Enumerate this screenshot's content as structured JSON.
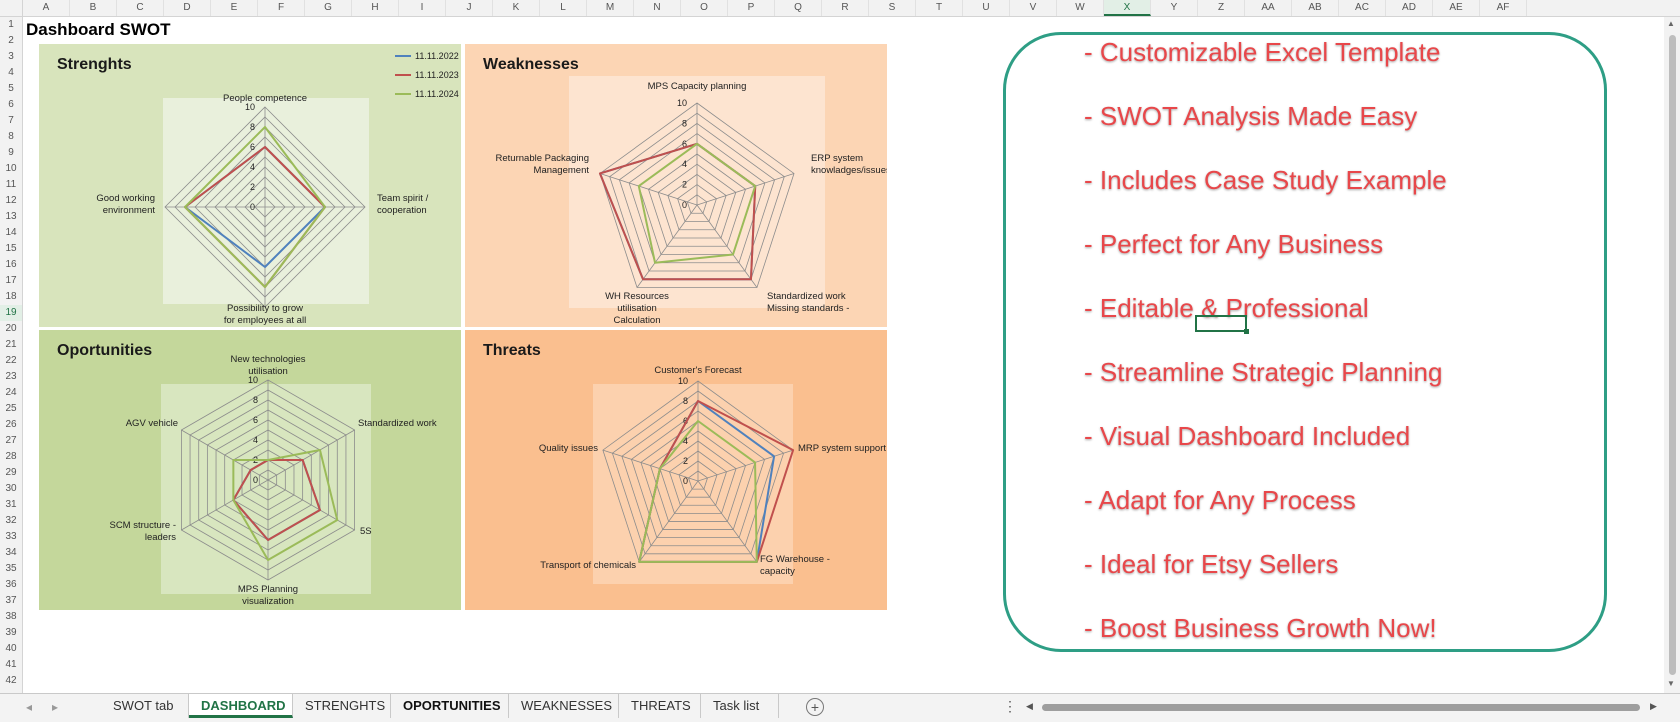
{
  "spreadsheet": {
    "columns": [
      "A",
      "B",
      "C",
      "D",
      "E",
      "F",
      "G",
      "H",
      "I",
      "J",
      "K",
      "L",
      "M",
      "N",
      "O",
      "P",
      "Q",
      "R",
      "S",
      "T",
      "U",
      "V",
      "W",
      "X",
      "Y",
      "Z",
      "AA",
      "AB",
      "AC",
      "AD",
      "AE",
      "AF"
    ],
    "selected_column": "X",
    "rows": [
      "1",
      "2",
      "3",
      "4",
      "5",
      "6",
      "7",
      "8",
      "9",
      "10",
      "11",
      "12",
      "13",
      "14",
      "15",
      "16",
      "17",
      "18",
      "19",
      "20",
      "21",
      "22",
      "23",
      "24",
      "25",
      "26",
      "27",
      "28",
      "29",
      "30",
      "31",
      "32",
      "33",
      "34",
      "35",
      "36",
      "37",
      "38",
      "39",
      "40",
      "41",
      "42"
    ],
    "selected_row": "19",
    "title": "Dashboard SWOT"
  },
  "legend": [
    "11.11.2022",
    "11.11.2023",
    "11.11.2024"
  ],
  "series_colors": [
    "#4f81bd",
    "#c0504d",
    "#9bbb59"
  ],
  "panels": {
    "strengths_title": "Strenghts",
    "weaknesses_title": "Weaknesses",
    "opportunities_title": "Oportunities",
    "threats_title": "Threats"
  },
  "chart_data": [
    {
      "type": "radar",
      "title": "Strenghts",
      "categories": [
        "People competence",
        "Team spirit / cooperation",
        "Possibility to grow for employees at all levels",
        "Good working environment"
      ],
      "rlim": [
        0,
        10
      ],
      "ticks": [
        "0",
        "2",
        "4",
        "6",
        "8",
        "10"
      ],
      "series": [
        {
          "name": "11.11.2022",
          "values": [
            6,
            6,
            6,
            8
          ]
        },
        {
          "name": "11.11.2023",
          "values": [
            6,
            6,
            8,
            8
          ]
        },
        {
          "name": "11.11.2024",
          "values": [
            8,
            6,
            8,
            8
          ]
        }
      ]
    },
    {
      "type": "radar",
      "title": "Weaknesses",
      "categories": [
        "MPS Capacity planning",
        "ERP system knowladges/issues",
        "Standardized work Missing standards -",
        "WH Resources utilisation Calculation",
        "Returnable Packaging Management"
      ],
      "rlim": [
        0,
        10
      ],
      "ticks": [
        "0",
        "2",
        "4",
        "6",
        "8",
        "10"
      ],
      "series": [
        {
          "name": "11.11.2022",
          "values": [
            6,
            6,
            9,
            9,
            10
          ]
        },
        {
          "name": "11.11.2023",
          "values": [
            6,
            6,
            9,
            9,
            10
          ]
        },
        {
          "name": "11.11.2024",
          "values": [
            6,
            6,
            6,
            7,
            6
          ]
        }
      ]
    },
    {
      "type": "radar",
      "title": "Oportunities",
      "categories": [
        "New technologies utilisation",
        "Standardized work",
        "5S",
        "MPS Planning visualization",
        "SCM structure - leaders",
        "AGV vehicle"
      ],
      "rlim": [
        0,
        10
      ],
      "ticks": [
        "0",
        "2",
        "4",
        "6",
        "8",
        "10"
      ],
      "series": [
        {
          "name": "11.11.2022",
          "values": [
            2,
            4,
            6,
            6,
            4,
            2
          ]
        },
        {
          "name": "11.11.2023",
          "values": [
            2,
            4,
            6,
            6,
            4,
            2
          ]
        },
        {
          "name": "11.11.2024",
          "values": [
            2,
            6,
            8,
            8,
            4,
            4
          ]
        }
      ]
    },
    {
      "type": "radar",
      "title": "Threats",
      "categories": [
        "Customer's Forecast",
        "MRP system support",
        "FG Warehouse - capacity",
        "Transport of chemicals",
        "Quality issues"
      ],
      "rlim": [
        0,
        10
      ],
      "ticks": [
        "0",
        "2",
        "4",
        "6",
        "8",
        "10"
      ],
      "series": [
        {
          "name": "11.11.2022",
          "values": [
            8,
            8,
            10,
            10,
            4
          ]
        },
        {
          "name": "11.11.2023",
          "values": [
            8,
            10,
            10,
            10,
            4
          ]
        },
        {
          "name": "11.11.2024",
          "values": [
            6,
            6,
            10,
            10,
            4
          ]
        }
      ]
    }
  ],
  "promo": {
    "items": [
      "- Customizable Excel Template",
      "- SWOT Analysis Made Easy",
      "- Includes Case Study Example",
      "- Perfect for Any Business",
      "- Editable & Professional",
      "- Streamline Strategic Planning",
      "- Visual Dashboard Included",
      "- Adapt for Any Process",
      "- Ideal for Etsy Sellers",
      "- Boost Business Growth Now!"
    ]
  },
  "tabs": [
    {
      "label": "SWOT tab",
      "active": false,
      "bold": false
    },
    {
      "label": "DASHBOARD",
      "active": true,
      "bold": false
    },
    {
      "label": "STRENGHTS",
      "active": false,
      "bold": false
    },
    {
      "label": "OPORTUNITIES",
      "active": false,
      "bold": true
    },
    {
      "label": "WEAKNESSES",
      "active": false,
      "bold": false
    },
    {
      "label": "THREATS",
      "active": false,
      "bold": false
    },
    {
      "label": "Task list",
      "active": false,
      "bold": false
    }
  ],
  "icons": {
    "nav_prev": "◂",
    "nav_next": "▸",
    "add_sheet": "+",
    "more": "⋮",
    "scroll_up": "▲",
    "scroll_down": "▼",
    "scroll_left": "◀",
    "scroll_right": "▶"
  }
}
